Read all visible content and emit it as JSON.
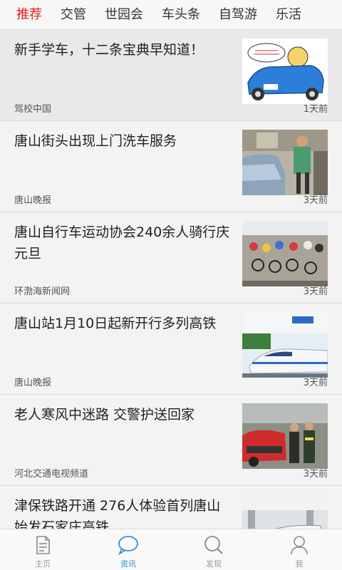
{
  "tabs": [
    {
      "label": "推荐",
      "active": true
    },
    {
      "label": "交管",
      "active": false
    },
    {
      "label": "世园会",
      "active": false
    },
    {
      "label": "车头条",
      "active": false
    },
    {
      "label": "自驾游",
      "active": false
    },
    {
      "label": "乐活",
      "active": false
    }
  ],
  "feed": [
    {
      "title": "新手学车，十二条宝典早知道！",
      "source": "驾校中国",
      "time": "1天前",
      "thumb": "cartoon-car"
    },
    {
      "title": "唐山街头出现上门洗车服务",
      "source": "唐山晚报",
      "time": "3天前",
      "thumb": "car-wash"
    },
    {
      "title": "唐山自行车运动协会240余人骑行庆元旦",
      "source": "环渤海新闻网",
      "time": "3天前",
      "thumb": "cyclists"
    },
    {
      "title": "唐山站1月10日起新开行多列高铁",
      "source": "唐山晚报",
      "time": "3天前",
      "thumb": "bullet-train"
    },
    {
      "title": "老人寒风中迷路 交警护送回家",
      "source": "河北交通电视频道",
      "time": "3天前",
      "thumb": "police-car"
    },
    {
      "title": "津保铁路开通 276人体验首列唐山始发石家庄高铁",
      "source": "",
      "time": "",
      "thumb": "train-station"
    }
  ],
  "bottom_nav": [
    {
      "label": "主页",
      "icon": "document-icon",
      "active": false
    },
    {
      "label": "资讯",
      "icon": "chat-bubble-icon",
      "active": true
    },
    {
      "label": "发现",
      "icon": "search-icon",
      "active": false
    },
    {
      "label": "我",
      "icon": "person-icon",
      "active": false
    }
  ],
  "colors": {
    "accent": "#e0201a",
    "nav_active": "#2b8fd6"
  }
}
